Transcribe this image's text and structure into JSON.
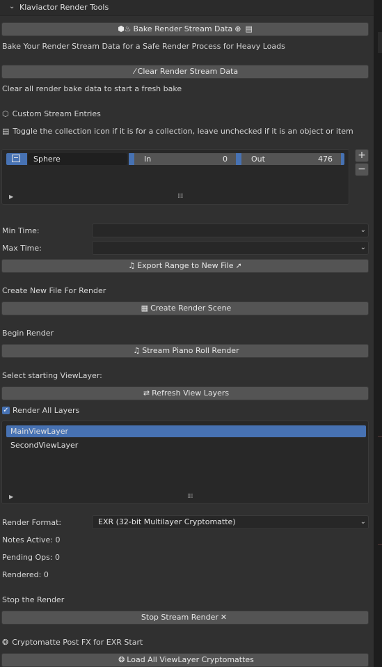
{
  "panel": {
    "title": "Klaviactor Render Tools"
  },
  "bake": {
    "button_label": "Bake Render Stream Data",
    "description": "Bake Your Render Stream Data for a Safe Render Process for Heavy Loads"
  },
  "clear": {
    "button_label": "Clear Render Stream Data",
    "description": "Clear all render bake data to start a fresh bake"
  },
  "custom_entries": {
    "heading": "Custom Stream Entries",
    "hint": "Toggle the collection icon if it is for a collection, leave unchecked if it is an object or item",
    "row": {
      "name": "Sphere",
      "in_label": "In",
      "in_value": "0",
      "out_label": "Out",
      "out_value": "476"
    },
    "add_symbol": "+",
    "remove_symbol": "−"
  },
  "time": {
    "min_label": "Min Time:",
    "max_label": "Max Time:",
    "min_value": "",
    "max_value": ""
  },
  "export": {
    "button_label": "Export Range to New File"
  },
  "new_file": {
    "heading": "Create New File For Render",
    "button_label": "Create Render Scene"
  },
  "begin": {
    "heading": "Begin Render",
    "button_label": "Stream Piano Roll Render"
  },
  "viewlayer": {
    "heading": "Select starting ViewLayer:",
    "refresh_label": "Refresh View Layers",
    "render_all_label": "Render All Layers",
    "render_all_checked": true,
    "items": [
      "MainViewLayer",
      "SecondViewLayer"
    ],
    "selected_index": 0
  },
  "format": {
    "label": "Render Format:",
    "value": "EXR (32-bit Multilayer Cryptomatte)"
  },
  "stats": {
    "notes_active": "Notes Active: 0",
    "pending_ops": "Pending Ops: 0",
    "rendered": "Rendered: 0"
  },
  "stop": {
    "heading": "Stop the Render",
    "button_label": "Stop Stream Render"
  },
  "crypto": {
    "heading": "Cryptomatte Post FX for EXR Start",
    "button_label": "Load All ViewLayer Cryptomattes"
  },
  "icons": {
    "bake": "cube-flame-icon",
    "clear": "broom-icon",
    "cube": "cube-icon",
    "collection": "collection-icon",
    "music": "music-note-icon",
    "clapper": "clapperboard-icon",
    "refresh": "refresh-icon",
    "close": "x-icon",
    "brain": "brain-icon"
  },
  "colors": {
    "accent": "#4772b3",
    "button": "#545454",
    "background": "#303030"
  }
}
